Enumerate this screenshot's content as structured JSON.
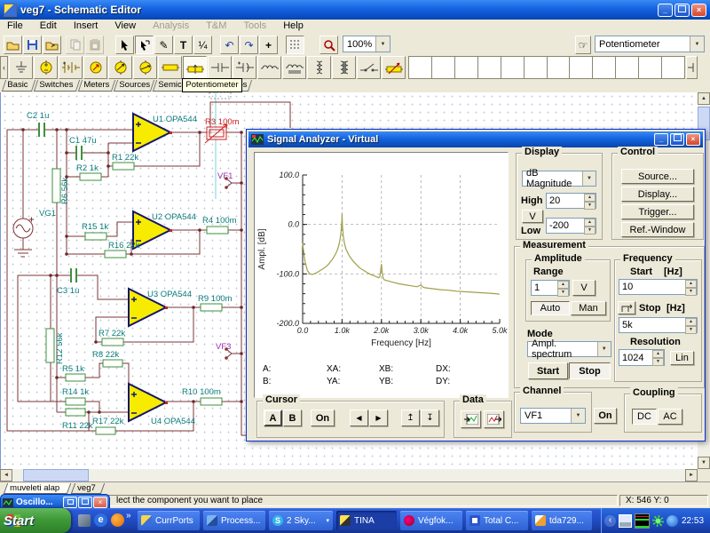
{
  "window": {
    "title": "veg7 - Schematic Editor",
    "menu": [
      "File",
      "Edit",
      "Insert",
      "View",
      "Analysis",
      "T&M",
      "Tools",
      "Help"
    ],
    "zoom": "100%",
    "component_combo": "Potentiometer",
    "component_tabs": [
      "Basic",
      "Switches",
      "Meters",
      "Sources",
      "Semiconducto",
      "bs"
    ],
    "tooltip": "Potentiometer",
    "sheet_tabs": [
      "muveleti alap",
      "veg7"
    ],
    "status_text": "lect the component you want to place",
    "status_coords": "X: 546 Y: 0"
  },
  "schematic": {
    "labels": {
      "c2": "C2 1u",
      "u1": "U1 OPA544",
      "r3": "R3 100m",
      "c1": "C1 47u",
      "r1": "R1 22k",
      "r2": "R2 1k",
      "r6": "R6 56k",
      "vg1": "VG1",
      "vf1": "VF1",
      "r15": "R15 1k",
      "u2": "U2 OPA544",
      "r4": "R4 100m",
      "r16": "R16 22k",
      "c3": "C3 1u",
      "u3": "U3 OPA544",
      "r9": "R9 100m",
      "r7": "R7 22k",
      "r12": "R12 56k",
      "r8": "R8 22k",
      "r5": "R5 1k",
      "r14": "R14 1k",
      "vf3": "VF3",
      "r17": "R17 22k",
      "u4": "U4 OPA544",
      "r10": "R10 100m",
      "r11": "R11 22k"
    }
  },
  "analyzer": {
    "title": "Signal Analyzer - Virtual",
    "display": {
      "cap": "Display",
      "mode": "dB Magnitude",
      "high": "High",
      "high_value": "20",
      "volt": "V",
      "low": "Low",
      "low_value": "-200"
    },
    "control": {
      "cap": "Control",
      "source": "Source...",
      "display": "Display...",
      "trigger": "Trigger...",
      "ref_window": "Ref.-Window"
    },
    "measurement": {
      "cap": "Measurement",
      "amplitude": {
        "cap": "Amplitude",
        "range": "Range",
        "value": "1",
        "volt": "V",
        "auto": "Auto",
        "man": "Man"
      },
      "mode_label": "Mode",
      "mode": "Ampl. spectrum",
      "start": "Start",
      "stop": "Stop",
      "frequency": {
        "cap": "Frequency",
        "start_label": "Start",
        "start_unit": "[Hz]",
        "start": "10",
        "stop_label": "Stop",
        "stop_unit": "[Hz]",
        "stop": "5k",
        "resolution_label": "Resolution",
        "resolution": "1024",
        "lin": "Lin"
      }
    },
    "channel": {
      "cap": "Channel",
      "value": "VF1",
      "on": "On"
    },
    "coupling": {
      "cap": "Coupling",
      "dc": "DC",
      "ac": "AC"
    },
    "cursor": {
      "cap": "Cursor",
      "a": "A",
      "b": "B",
      "on": "On"
    },
    "data_cap": "Data",
    "readout": [
      "A:",
      "XA:",
      "XB:",
      "DX:",
      "B:",
      "YA:",
      "YB:",
      "DY:"
    ]
  },
  "chart_data": {
    "type": "line",
    "title": "",
    "xlabel": "Frequency [Hz]",
    "ylabel": "Ampl. [dB]",
    "xlim": [
      0,
      5000
    ],
    "ylim": [
      -200,
      100
    ],
    "xticks": [
      0,
      1000,
      2000,
      3000,
      4000,
      5000
    ],
    "xtick_labels": [
      "0.0",
      "1.0k",
      "2.0k",
      "3.0k",
      "4.0k",
      "5.0k"
    ],
    "yticks": [
      100,
      0,
      -100,
      -200
    ],
    "ytick_labels": [
      "100.0",
      "0.0",
      "-100.0",
      "-200.0"
    ],
    "x_minor_step": 200,
    "y_minor_step": 20,
    "grid": "dashed, at interior major ticks",
    "legend": "none",
    "line_color": "#a0a048",
    "series": [
      {
        "name": "VF1 amplitude spectrum",
        "points": [
          [
            0,
            -38
          ],
          [
            20,
            -52
          ],
          [
            60,
            -75
          ],
          [
            120,
            -93
          ],
          [
            180,
            -100
          ],
          [
            250,
            -101
          ],
          [
            350,
            -98
          ],
          [
            450,
            -93
          ],
          [
            550,
            -88
          ],
          [
            650,
            -81
          ],
          [
            750,
            -71
          ],
          [
            820,
            -62
          ],
          [
            880,
            -52
          ],
          [
            920,
            -42
          ],
          [
            950,
            -30
          ],
          [
            975,
            -14
          ],
          [
            995,
            8
          ],
          [
            1000,
            22
          ],
          [
            1010,
            0
          ],
          [
            1030,
            -22
          ],
          [
            1060,
            -38
          ],
          [
            1100,
            -50
          ],
          [
            1180,
            -63
          ],
          [
            1260,
            -72
          ],
          [
            1350,
            -80
          ],
          [
            1450,
            -88
          ],
          [
            1550,
            -93
          ],
          [
            1650,
            -98
          ],
          [
            1750,
            -102
          ],
          [
            1850,
            -105
          ],
          [
            1930,
            -108
          ],
          [
            1965,
            -104
          ],
          [
            1985,
            -90
          ],
          [
            2000,
            -80
          ],
          [
            2015,
            -95
          ],
          [
            2040,
            -108
          ],
          [
            2070,
            -112
          ],
          [
            2150,
            -114
          ],
          [
            2300,
            -117
          ],
          [
            2450,
            -120
          ],
          [
            2600,
            -122
          ],
          [
            2750,
            -124
          ],
          [
            2900,
            -126
          ],
          [
            2960,
            -124
          ],
          [
            3000,
            -122
          ],
          [
            3040,
            -126
          ],
          [
            3100,
            -128
          ],
          [
            3300,
            -130
          ],
          [
            3500,
            -132
          ],
          [
            3700,
            -133
          ],
          [
            3900,
            -135
          ],
          [
            4100,
            -136
          ],
          [
            4300,
            -137
          ],
          [
            4500,
            -138
          ],
          [
            4700,
            -139
          ],
          [
            4900,
            -140
          ],
          [
            5000,
            -141
          ]
        ]
      }
    ]
  },
  "oscillo_title": "Oscillo...",
  "taskbar": {
    "start": "Start",
    "buttons": [
      "CurrPorts",
      "Process...",
      "2 Sky...",
      "TINA",
      "Végfok...",
      "Total C...",
      "tda729..."
    ],
    "active_button": "TINA",
    "clock": "22:53"
  },
  "icons": {
    "dropdown_arrow": "▼",
    "spinner_up": "▲",
    "spinner_down": "▼",
    "cursor_left": "◀",
    "cursor_right": "▶",
    "cursor_up": "↥",
    "cursor_down": "↧",
    "scroll_left": "◄",
    "scroll_right": "►",
    "scroll_up": "▲",
    "scroll_down": "▼",
    "tab_scroll_left": "‹",
    "hand": "☞",
    "pen": "✎",
    "text_tool": "T",
    "fraction": "¼",
    "undo": "↶",
    "redo": "↷",
    "plus": "+",
    "quick_launch_more": "»",
    "tray_chevron": "‹",
    "skype_dropdown": "▾",
    "minimize": "_",
    "close": "×"
  },
  "colors": {
    "titlebar": "#1563e0",
    "taskbar": "#1d44b4",
    "opamp_fill": "#f7ec00",
    "wire": "#7b3434",
    "component_label": "#0b7b7b",
    "curve": "#a0a048",
    "placing_component": "#cc2222",
    "probe_label": "#9b30b0"
  }
}
